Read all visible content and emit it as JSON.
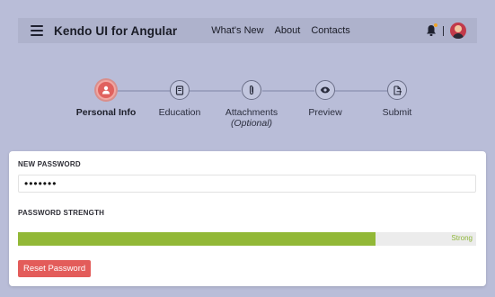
{
  "appbar": {
    "title": "Kendo UI for Angular",
    "nav": [
      {
        "label": "What's New"
      },
      {
        "label": "About"
      },
      {
        "label": "Contacts"
      }
    ]
  },
  "stepper": {
    "steps": [
      {
        "label": "Personal Info",
        "icon": "user-icon",
        "active": true
      },
      {
        "label": "Education",
        "icon": "book-icon",
        "active": false
      },
      {
        "label": "Attachments",
        "sublabel": "(Optional)",
        "icon": "paperclip-icon",
        "active": false
      },
      {
        "label": "Preview",
        "icon": "eye-icon",
        "active": false
      },
      {
        "label": "Submit",
        "icon": "file-export-icon",
        "active": false
      }
    ],
    "current_step": 1
  },
  "form": {
    "password_label": "NEW PASSWORD",
    "password_value": "•••••••",
    "strength_label": "PASSWORD STRENGTH",
    "strength_text": "Strong",
    "strength_fraction": 0.78,
    "reset_label": "Reset Password"
  },
  "colors": {
    "background": "#b9bdd8",
    "appbar": "#aeb2cc",
    "accent": "#e0625e",
    "strength": "#92b837"
  }
}
